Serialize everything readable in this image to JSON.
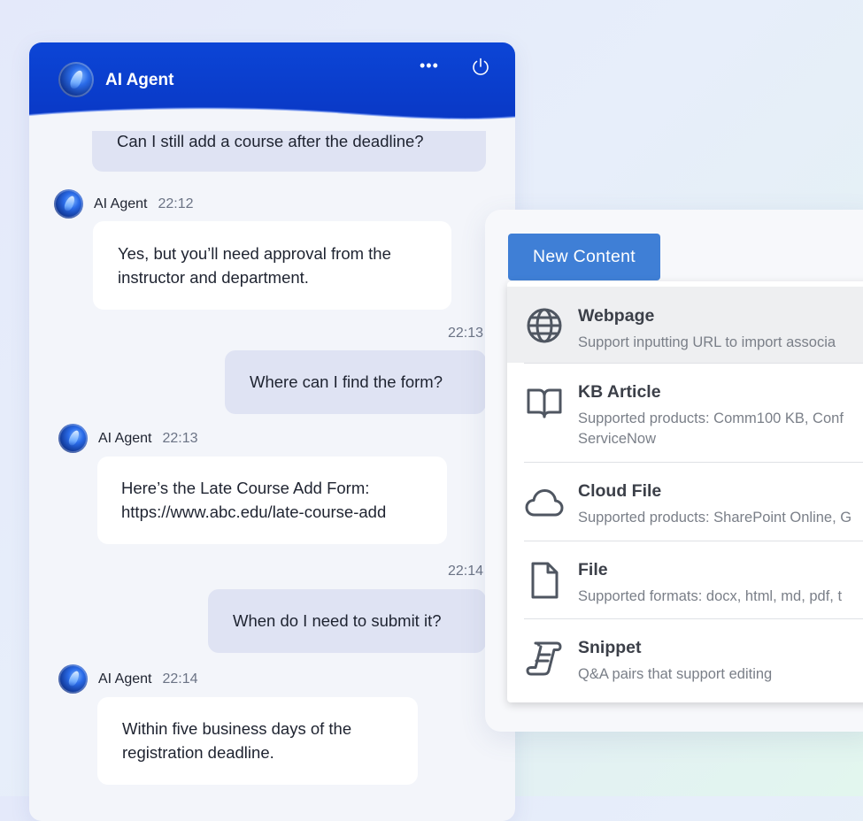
{
  "header": {
    "title": "AI Agent",
    "more_label": "•••"
  },
  "conversation": {
    "msg1_user": "Can I still add a course after the deadline?",
    "msg2_agent_name": "AI Agent",
    "msg2_time": "22:12",
    "msg2_line1": "Yes, but you’ll need approval from the",
    "msg2_line2": "instructor and department.",
    "msg3_time": "22:13",
    "msg3_user": "Where can I find the form?",
    "msg4_agent_name": "AI Agent",
    "msg4_time": "22:13",
    "msg4_line1": "Here’s the Late Course Add Form:",
    "msg4_line2": "https://www.abc.edu/late-course-add",
    "msg5_time": "22:14",
    "msg5_user": "When do I need to submit it?",
    "msg6_agent_name": "AI Agent",
    "msg6_time": "22:14",
    "msg6_line1": "Within five business days of the",
    "msg6_line2": "registration deadline."
  },
  "content_panel": {
    "new_content_label": "New Content",
    "items": [
      {
        "icon": "globe-icon",
        "title": "Webpage",
        "desc": [
          "Support inputting URL to import associa"
        ]
      },
      {
        "icon": "book-icon",
        "title": "KB Article",
        "desc": [
          "Supported products: Comm100 KB, Conf",
          "ServiceNow"
        ]
      },
      {
        "icon": "cloud-icon",
        "title": "Cloud File",
        "desc": [
          "Supported products: SharePoint Online, G"
        ]
      },
      {
        "icon": "file-icon",
        "title": "File",
        "desc": [
          "Supported formats: docx, html, md, pdf, t"
        ]
      },
      {
        "icon": "snippet-icon",
        "title": "Snippet",
        "desc": [
          "Q&A pairs that support editing"
        ]
      }
    ]
  },
  "colors": {
    "header_blue": "#0a3fd0",
    "button_blue": "#3f7fd6",
    "user_bubble": "#dfe3f3",
    "agent_bubble": "#ffffff"
  }
}
